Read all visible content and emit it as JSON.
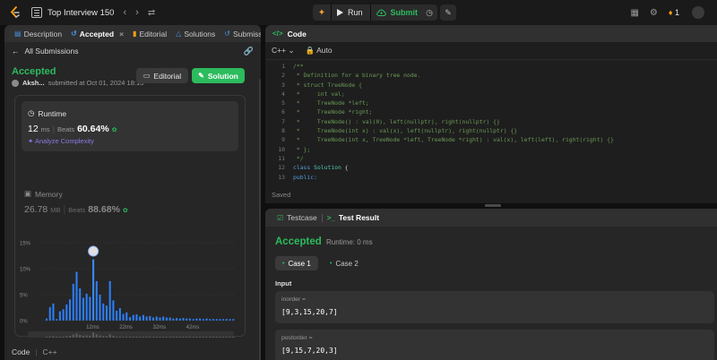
{
  "topbar": {
    "problem_list": "Top Interview 150",
    "run": "Run",
    "submit": "Submit",
    "streak": "1"
  },
  "tabs": [
    {
      "label": "Description",
      "icon": "description-icon"
    },
    {
      "label": "Accepted",
      "icon": "history-icon"
    },
    {
      "label": "Editorial",
      "icon": "book-icon"
    },
    {
      "label": "Solutions",
      "icon": "flask-icon"
    },
    {
      "label": "Submissi",
      "icon": "history-icon"
    }
  ],
  "submission": {
    "back": "All Submissions",
    "status": "Accepted",
    "user": "Aksh...",
    "submitted_at": "submitted at Oct 01, 2024 18:13",
    "editorial_btn": "Editorial",
    "solution_btn": "Solution",
    "runtime_label": "Runtime",
    "runtime_value": "12",
    "runtime_unit": "ms",
    "beats_label": "Beats",
    "runtime_beats": "60.64%",
    "analyze": "Analyze Complexity",
    "memory_label": "Memory",
    "memory_value": "26.78",
    "memory_unit": "MB",
    "memory_beats": "88.68%",
    "code_label": "Code",
    "language": "C++"
  },
  "chart_data": {
    "type": "bar",
    "y_ticks": [
      "15%",
      "10%",
      "5%",
      "0%"
    ],
    "x_ticks": [
      "12ms",
      "22ms",
      "32ms",
      "42ms"
    ],
    "highlight": "12ms",
    "ylim": [
      0,
      15
    ],
    "values": [
      0.4,
      2.6,
      3.3,
      0.3,
      1.8,
      2.2,
      3.1,
      4.1,
      7.1,
      9.4,
      6.2,
      4.4,
      5.2,
      4.6,
      11.8,
      7.6,
      5.0,
      3.3,
      2.9,
      7.6,
      3.9,
      1.9,
      2.4,
      1.3,
      1.6,
      0.7,
      1.1,
      1.2,
      0.8,
      1.1,
      0.8,
      0.9,
      0.6,
      0.8,
      0.6,
      0.8,
      0.6,
      0.6,
      0.4,
      0.5,
      0.4,
      0.5,
      0.4,
      0.4,
      0.3,
      0.4,
      0.4,
      0.3,
      0.4,
      0.3,
      0.3,
      0.3,
      0.3,
      0.3,
      0.3,
      0.3,
      0.3
    ],
    "mini_x_ticks": [
      "12ms",
      "22ms",
      "32ms",
      "42ms"
    ]
  },
  "code": {
    "title": "Code",
    "language": "C++",
    "mode": "Auto",
    "lines": [
      "/**",
      " * Definition for a binary tree node.",
      " * struct TreeNode {",
      " *     int val;",
      " *     TreeNode *left;",
      " *     TreeNode *right;",
      " *     TreeNode() : val(0), left(nullptr), right(nullptr) {}",
      " *     TreeNode(int x) : val(x), left(nullptr), right(nullptr) {}",
      " *     TreeNode(int x, TreeNode *left, TreeNode *right) : val(x), left(left), right(right) {}",
      " * };",
      " */",
      "class Solution {",
      "public:"
    ],
    "saved": "Saved"
  },
  "test": {
    "tab_testcase": "Testcase",
    "tab_result": "Test Result",
    "status": "Accepted",
    "runtime": "Runtime: 0 ms",
    "case1": "Case 1",
    "case2": "Case 2",
    "input_label": "Input",
    "inorder_label": "inorder =",
    "inorder_value": "[9,3,15,20,7]",
    "postorder_label": "postorder =",
    "postorder_value": "[9,15,7,20,3]"
  },
  "colors": {
    "accent_green": "#2cbb5d",
    "bar_blue": "#2d7ff9",
    "orange": "#ffa116"
  }
}
